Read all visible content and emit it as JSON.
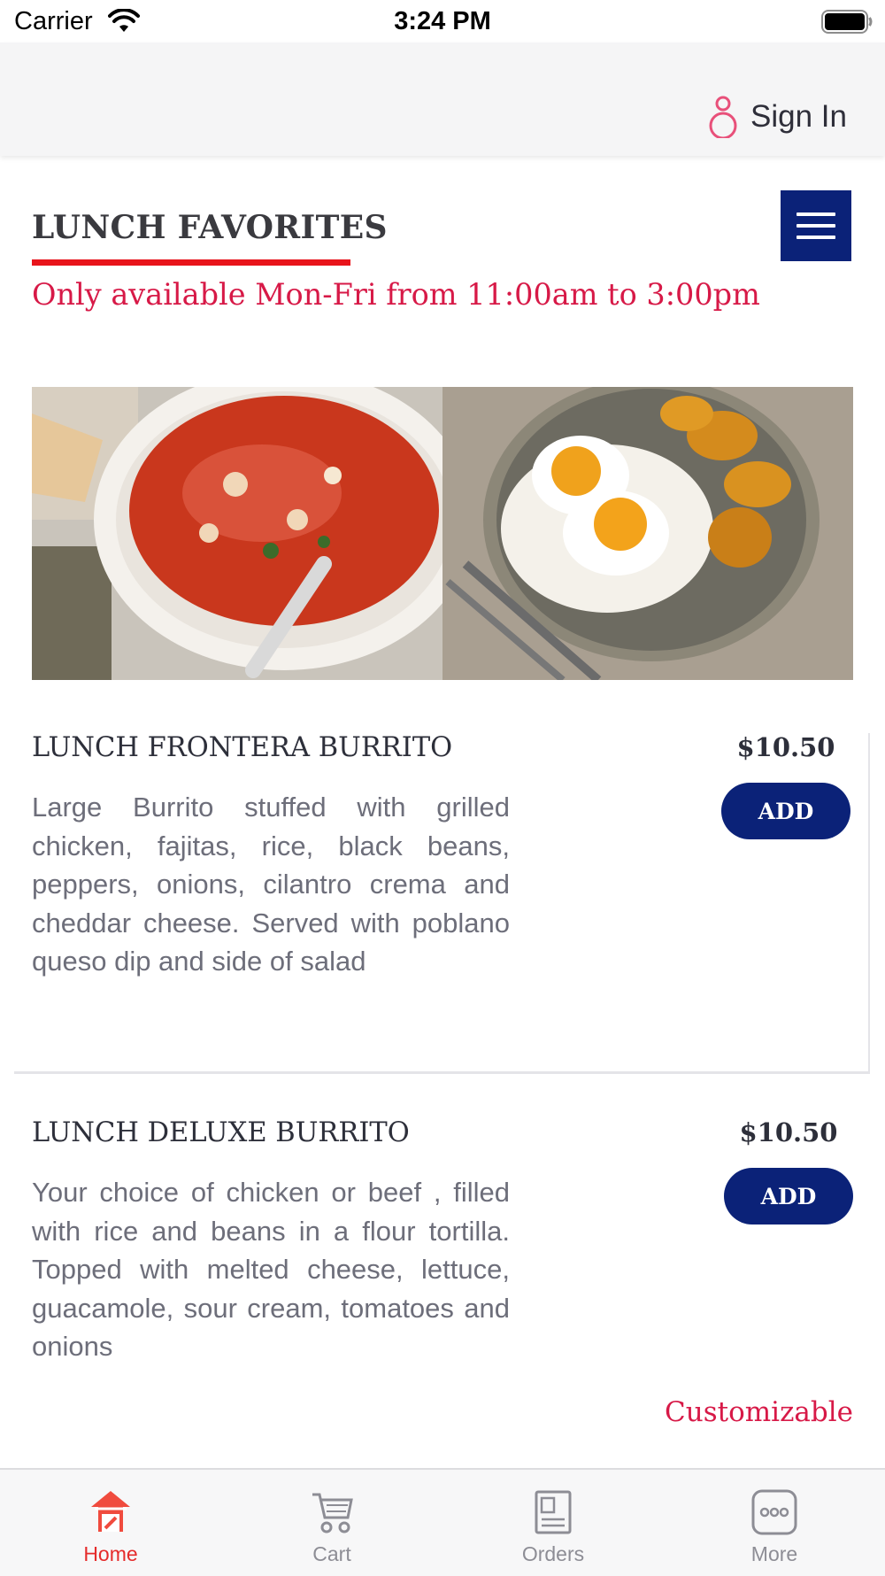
{
  "status_bar": {
    "carrier": "Carrier",
    "time": "3:24 PM"
  },
  "header": {
    "sign_in_label": "Sign In"
  },
  "section": {
    "title": "LUNCH FAVORITES",
    "availability": "Only available Mon-Fri from 11:00am to 3:00pm"
  },
  "items": [
    {
      "name": "LUNCH FRONTERA BURRITO",
      "price": "$10.50",
      "add_label": "ADD",
      "description": "Large Burrito stuffed with grilled chicken, fajitas, rice, black beans, peppers, onions, cilantro crema and cheddar cheese. Served with poblano queso dip and side of salad"
    },
    {
      "name": "LUNCH DELUXE BURRITO",
      "price": "$10.50",
      "add_label": "ADD",
      "description": "Your choice of chicken or beef , filled with rice and beans in a flour tortilla. Topped with melted cheese, lettuce, guacamole, sour cream, tomatoes and onions",
      "customizable_label": "Customizable"
    }
  ],
  "tabs": [
    {
      "label": "Home",
      "icon": "home-icon",
      "active": true
    },
    {
      "label": "Cart",
      "icon": "cart-icon",
      "active": false
    },
    {
      "label": "Orders",
      "icon": "orders-icon",
      "active": false
    },
    {
      "label": "More",
      "icon": "more-icon",
      "active": false
    }
  ],
  "colors": {
    "navy": "#0b2278",
    "accent_red": "#d71947",
    "underline_red": "#e8141b",
    "tab_active": "#e52b2b"
  }
}
